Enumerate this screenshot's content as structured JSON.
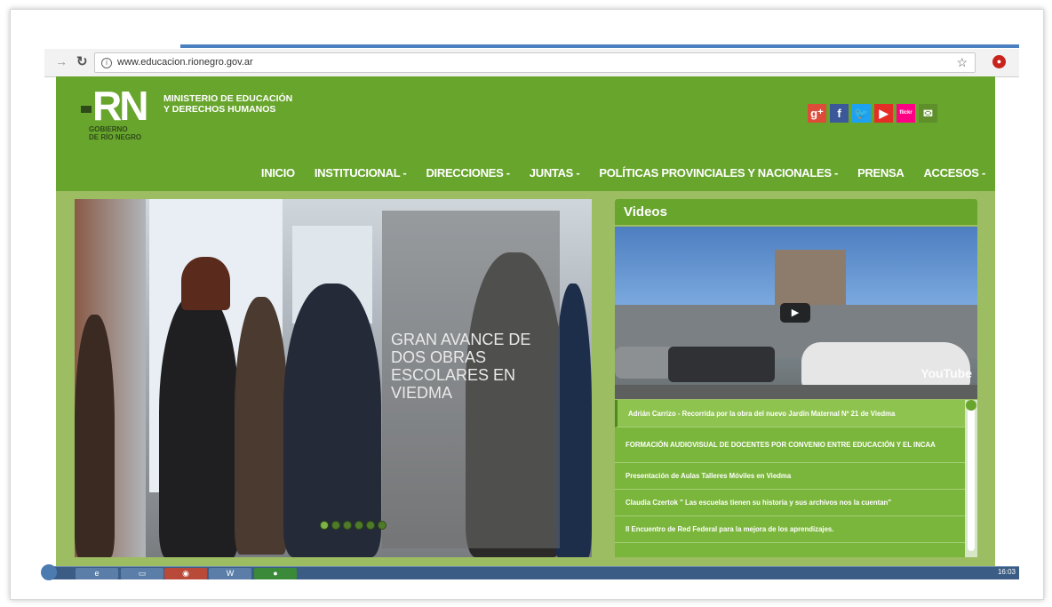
{
  "browser": {
    "url": "www.educacion.rionegro.gov.ar"
  },
  "header": {
    "logo_text": "RN",
    "ministry_line1": "MINISTERIO DE EDUCACIÓN",
    "ministry_line2": "Y DERECHOS HUMANOS",
    "gob_line1": "GOBIERNO",
    "gob_line2": "DE RÍO NEGRO",
    "social": [
      {
        "name": "google-plus-icon",
        "glyph": "g⁺",
        "color": "#dd4b39"
      },
      {
        "name": "facebook-icon",
        "glyph": "f",
        "color": "#3b5998"
      },
      {
        "name": "twitter-icon",
        "glyph": "🐦",
        "color": "#1da1f2"
      },
      {
        "name": "youtube-icon",
        "glyph": "▶",
        "color": "#e52d27"
      },
      {
        "name": "flickr-icon",
        "glyph": "flickr",
        "color": "#ff0084"
      },
      {
        "name": "mail-icon",
        "glyph": "✉",
        "color": "#5e8f2b"
      }
    ]
  },
  "nav": {
    "items": [
      "INICIO",
      "INSTITUCIONAL -",
      "DIRECCIONES -",
      "JUNTAS -",
      "POLÍTICAS PROVINCIALES Y NACIONALES -",
      "PRENSA",
      "ACCESOS -"
    ]
  },
  "slider": {
    "caption": "GRAN AVANCE DE DOS OBRAS ESCOLARES EN VIEDMA",
    "dot_count": 6,
    "active_dot": 0
  },
  "videos": {
    "title": "Videos",
    "youtube_label": "YouTube",
    "items": [
      "Adrián Carrizo - Recorrida por la obra del nuevo Jardín Maternal Nº 21 de Viedma",
      "FORMACIÓN AUDIOVISUAL DE DOCENTES POR CONVENIO ENTRE EDUCACIÓN Y EL INCAA",
      "Presentación de Aulas Talleres Móviles en Viedma",
      "Claudia Czertok \" Las escuelas tienen su historia y sus archivos nos la cuentan\"",
      "II Encuentro de Red Federal para la mejora de los aprendizajes."
    ]
  },
  "taskbar": {
    "clock": "16:03"
  }
}
